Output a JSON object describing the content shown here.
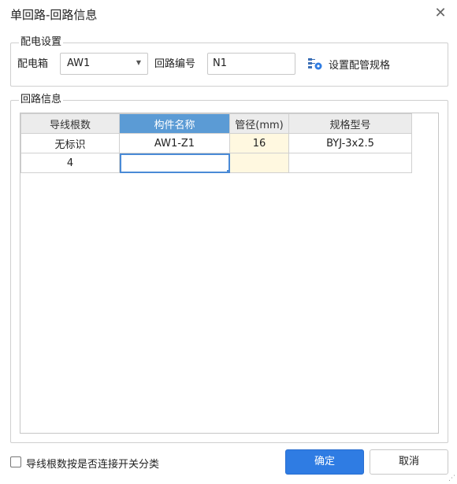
{
  "dialog": {
    "title": "单回路-回路信息",
    "close_icon": "close-icon"
  },
  "dist_settings": {
    "legend": "配电设置",
    "box_label": "配电箱",
    "box_value": "AW1",
    "circuit_label": "回路编号",
    "circuit_value": "N1",
    "config_button_label": "设置配管规格",
    "config_icon": "pipe-config-icon"
  },
  "circuit_info": {
    "legend": "回路信息",
    "columns": [
      "导线根数",
      "构件名称",
      "管径(mm)",
      "规格型号"
    ],
    "selected_column": 1,
    "rows": [
      [
        "无标识",
        "AW1-Z1",
        "16",
        "BYJ-3x2.5"
      ],
      [
        "4",
        "",
        "",
        ""
      ]
    ]
  },
  "footer": {
    "checkbox_label": "导线根数按是否连接开关分类",
    "checkbox_checked": false,
    "ok_label": "确定",
    "cancel_label": "取消"
  },
  "colors": {
    "primary": "#2f7ce3",
    "selected_header": "#5b9bd5",
    "highlight_cell": "#fff8e0"
  }
}
